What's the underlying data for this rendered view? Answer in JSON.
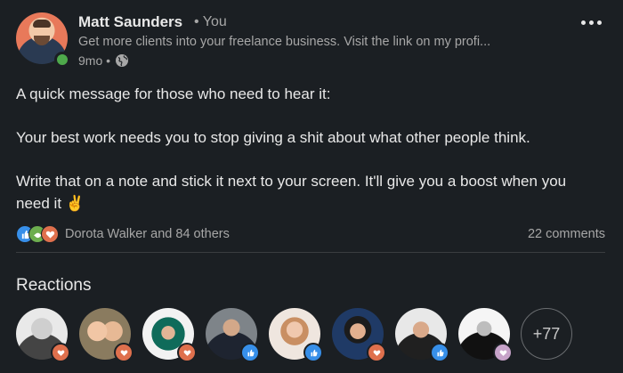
{
  "post": {
    "author": {
      "name": "Matt Saunders",
      "degree": "• You",
      "headline": "Get more clients into your freelance business. Visit the link on my profi...",
      "time": "9mo •"
    },
    "body": {
      "line1": "A quick message for those who need to hear it:",
      "line2": "Your best work needs you to stop giving a shit about what other people think.",
      "line3": "Write that on a note and stick it next to your screen. It'll give you a boost when you need it",
      "emoji": "✌"
    },
    "social": {
      "reactions_summary": "Dorota Walker and 84 others",
      "comments": "22 comments"
    }
  },
  "reactions": {
    "title": "Reactions",
    "people": [
      {
        "reaction": "love"
      },
      {
        "reaction": "love"
      },
      {
        "reaction": "love"
      },
      {
        "reaction": "like"
      },
      {
        "reaction": "like"
      },
      {
        "reaction": "love"
      },
      {
        "reaction": "like"
      },
      {
        "reaction": "support"
      }
    ],
    "more": "+77"
  },
  "colors": {
    "background": "#1b1f23",
    "like": "#378fe9",
    "love": "#df704d",
    "support": "#6dae4f",
    "online": "#4ea94b"
  }
}
